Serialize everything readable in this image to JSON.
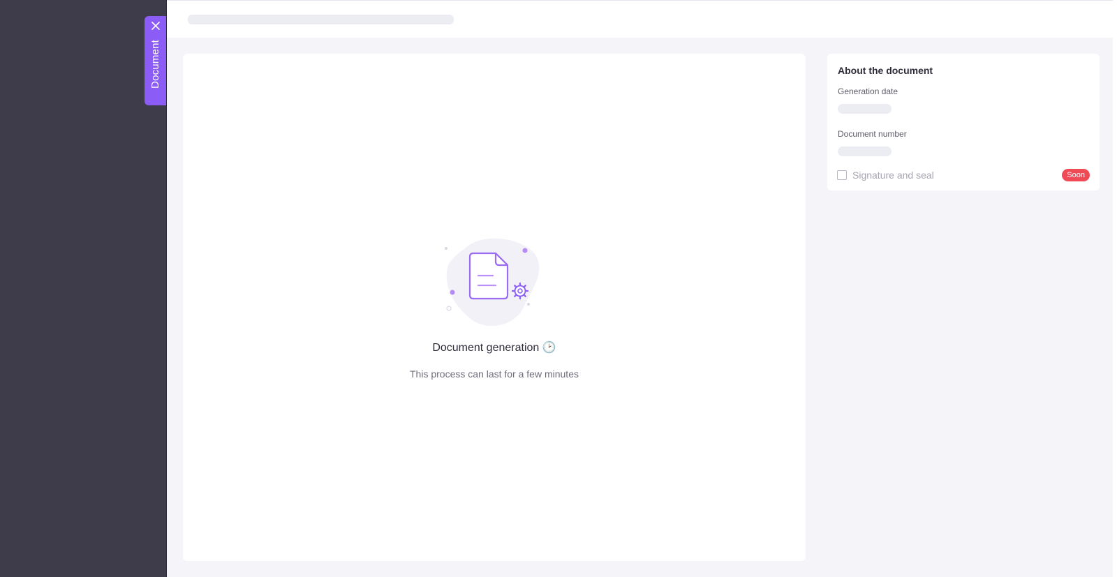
{
  "drawer": {
    "tab_label": "Document",
    "close_icon": "close-icon"
  },
  "preview": {
    "title": "Document generation 🕑",
    "subtitle": "This process can last for a few minutes",
    "illustration_icons": [
      "document-icon",
      "gear-icon"
    ]
  },
  "about": {
    "title": "About the document",
    "generation_date_label": "Generation date",
    "document_number_label": "Document number",
    "signature_label": "Signature and seal",
    "signature_checked": false,
    "badge": "Soon"
  },
  "colors": {
    "accent": "#8b5cf6",
    "badge": "#ef4a55",
    "backdrop": "#3e3b4b"
  }
}
